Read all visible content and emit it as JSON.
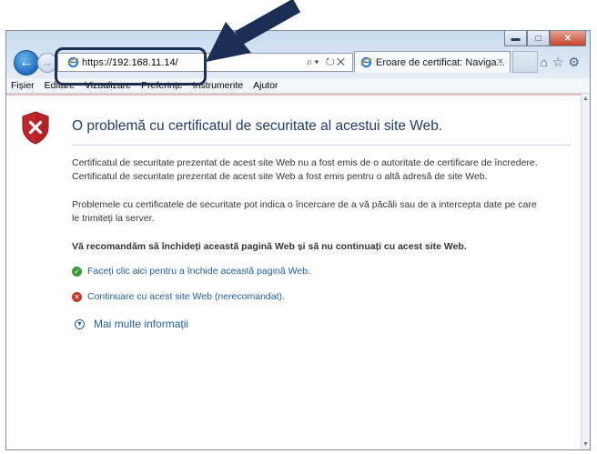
{
  "browser": {
    "url_prefix": "https://",
    "url_host": "192.168.11.14/",
    "tab_title": "Eroare de certificat: Naviga...",
    "tab_close": "×"
  },
  "window_controls": {
    "minimize": "▬",
    "maximize": "□",
    "close": "✕"
  },
  "menu": {
    "items": [
      "Fișier",
      "Editare",
      "Vizualizare",
      "Preferințe",
      "Instrumente",
      "Ajutor"
    ]
  },
  "page": {
    "title": "O problemă cu certificatul de securitate al acestui site Web.",
    "para1_line1": "Certificatul de securitate prezentat de acest site Web nu a fost emis de o autoritate de certificare de încredere.",
    "para1_line2": "Certificatul de securitate prezentat de acest site Web a fost emis pentru o altă adresă de site Web.",
    "para2_line1": "Problemele cu certificatele de securitate pot indica o încercare de a vă păcăli sau de a intercepta date pe care",
    "para2_line2": "le trimiteți la server.",
    "recommendation": "Vă recomandăm să închideți această pagină Web și să nu continuați cu acest site Web.",
    "option_close": "Faceți clic aici pentru a închide această pagină Web.",
    "option_continue": "Continuare cu acest site Web (nerecomandat).",
    "more_info": "Mai multe informații"
  },
  "icons": [
    "back-arrow-icon",
    "forward-arrow-icon",
    "ie-logo-icon",
    "search-icon",
    "refresh-icon",
    "stop-icon",
    "home-icon",
    "favorites-star-icon",
    "gear-icon",
    "shield-error-icon",
    "checkmark-shield-icon",
    "x-shield-icon",
    "expand-chevron-icon"
  ],
  "colors": {
    "callout": "#1b2f55",
    "link": "#1f5fa0",
    "title": "#1f3c6b"
  }
}
